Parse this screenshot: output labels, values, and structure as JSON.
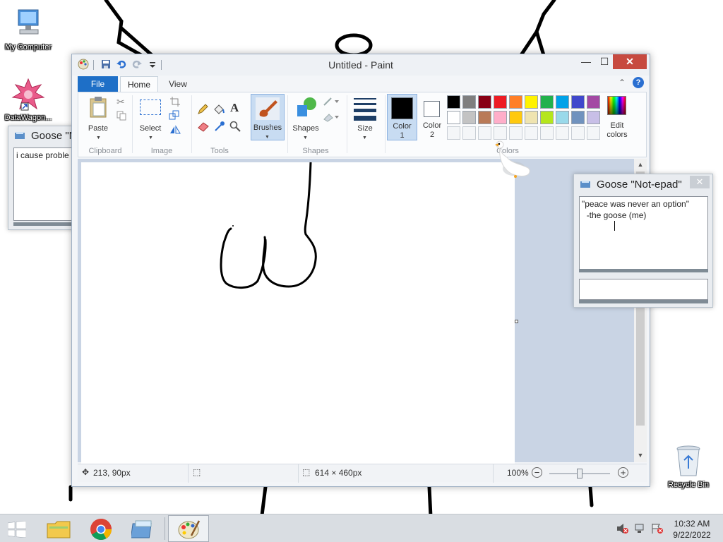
{
  "desktop": {
    "icons": [
      {
        "label": "My Computer"
      },
      {
        "label": "DataWagon..."
      },
      {
        "label": "Recycle Bin"
      }
    ]
  },
  "goose_left": {
    "title": "Goose \"N",
    "text": "i cause proble"
  },
  "goose_right": {
    "title": "Goose \"Not-epad\"",
    "text": "\"peace was never an option\"\n  -the goose (me)"
  },
  "paint": {
    "title": "Untitled - Paint",
    "tabs": {
      "file": "File",
      "home": "Home",
      "view": "View"
    },
    "ribbon": {
      "paste": "Paste",
      "clipboard": "Clipboard",
      "select": "Select",
      "image": "Image",
      "tools": "Tools",
      "brushes": "Brushes",
      "shapes_btn": "Shapes",
      "shapes_group": "Shapes",
      "size": "Size",
      "color1_a": "Color",
      "color1_b": "1",
      "color2_a": "Color",
      "color2_b": "2",
      "colors_group": "Colors",
      "edit_colors_a": "Edit",
      "edit_colors_b": "colors"
    },
    "palette_row1": [
      "#000000",
      "#7f7f7f",
      "#880015",
      "#ed1c24",
      "#ff7f27",
      "#fff200",
      "#22b14c",
      "#00a2e8",
      "#3f48cc",
      "#a349a4"
    ],
    "palette_row2": [
      "#ffffff",
      "#c3c3c3",
      "#b97a57",
      "#ffaec9",
      "#ffc90e",
      "#efe4b0",
      "#b5e61d",
      "#99d9ea",
      "#7092be",
      "#c8bfe7"
    ],
    "color1": "#000000",
    "color2": "#ffffff",
    "status": {
      "cursor_pos": "213, 90px",
      "canvas_size": "614 × 460px",
      "zoom": "100%"
    }
  },
  "taskbar": {
    "time": "10:32 AM",
    "date": "9/22/2022"
  }
}
